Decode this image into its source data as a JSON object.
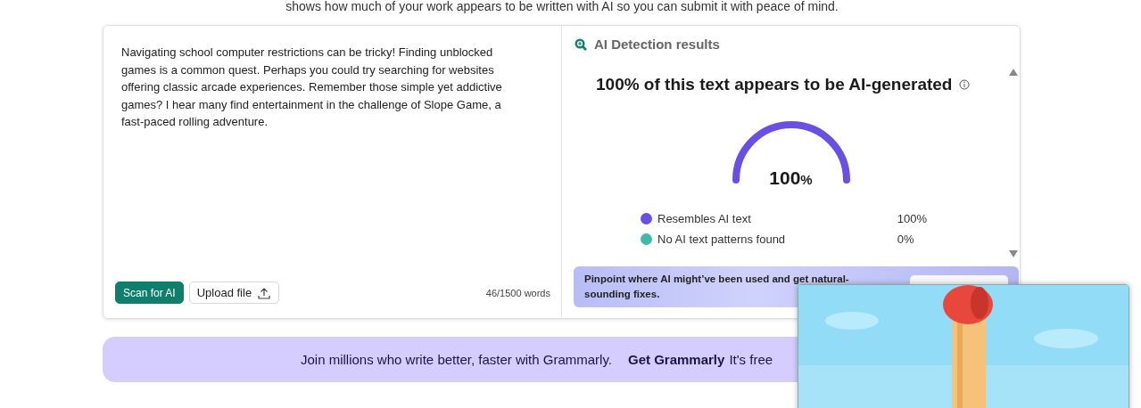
{
  "intro": "shows how much of your work appears to be written with AI so you can submit it with peace of mind.",
  "editor": {
    "text": "Navigating school computer restrictions can be tricky! Finding unblocked games is a common quest. Perhaps you could try searching for websites offering classic arcade experiences. Remember those simple yet addictive games? I hear many find entertainment in the challenge of Slope Game, a fast-paced rolling adventure.",
    "buttons": [
      "Scan for AI",
      "Upload file"
    ],
    "word_count": "46/1500 words"
  },
  "results": {
    "title": "AI Detection results",
    "headline": "100% of this text appears to be AI-generated",
    "gauge": {
      "number": "100",
      "unit": "%"
    },
    "legend": [
      {
        "label": "Resembles AI text",
        "value": "100%",
        "color": "#6a4fe3"
      },
      {
        "label": "No AI text patterns found",
        "value": "0%",
        "color": "#3dbaa8"
      }
    ],
    "promo": "Pinpoint where AI might’ve been used and get natural-sounding fixes."
  },
  "banner": {
    "text": "Join millions who write better, faster with Grammarly.",
    "link": "Get Grammarly",
    "note": "It's free"
  }
}
